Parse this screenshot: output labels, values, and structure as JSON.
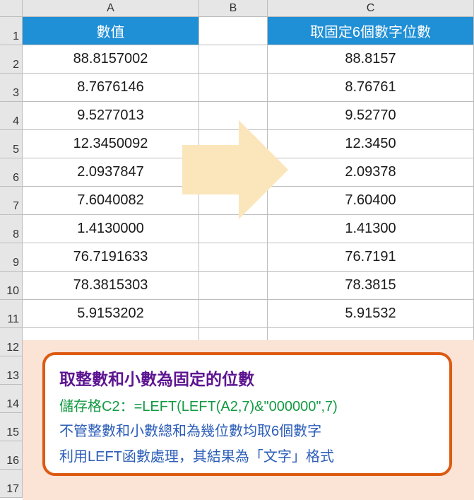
{
  "columns": {
    "A": "A",
    "B": "B",
    "C": "C"
  },
  "headers": {
    "A": "數值",
    "C": "取固定6個數字位數"
  },
  "rows": [
    {
      "n": "1"
    },
    {
      "n": "2",
      "a": "88.8157002",
      "c": "88.8157"
    },
    {
      "n": "3",
      "a": "8.7676146",
      "c": "8.76761"
    },
    {
      "n": "4",
      "a": "9.5277013",
      "c": "9.52770"
    },
    {
      "n": "5",
      "a": "12.3450092",
      "c": "12.3450"
    },
    {
      "n": "6",
      "a": "2.0937847",
      "c": "2.09378"
    },
    {
      "n": "7",
      "a": "7.6040082",
      "c": "7.60400"
    },
    {
      "n": "8",
      "a": "1.4130000",
      "c": "1.41300"
    },
    {
      "n": "9",
      "a": "76.7191633",
      "c": "76.7191"
    },
    {
      "n": "10",
      "a": "78.3815303",
      "c": "78.3815"
    },
    {
      "n": "11",
      "a": "5.9153202",
      "c": "5.91532"
    },
    {
      "n": "12"
    },
    {
      "n": "13"
    },
    {
      "n": "14"
    },
    {
      "n": "15"
    },
    {
      "n": "16"
    },
    {
      "n": "17"
    }
  ],
  "box": {
    "title": "取整數和小數為固定的位數",
    "formula": "儲存格C2：=LEFT(LEFT(A2,7)&\"000000\",7)",
    "note1": "不管整數和小數總和為幾位數均取6個數字",
    "note2": "利用LEFT函數處理，其結果為「文字」格式"
  },
  "chart_data": {
    "type": "table",
    "title": "Excel: fixed 6-digit extraction using LEFT",
    "columns": [
      "數值",
      "取固定6個數字位數"
    ],
    "data": [
      [
        "88.8157002",
        "88.8157"
      ],
      [
        "8.7676146",
        "8.76761"
      ],
      [
        "9.5277013",
        "9.52770"
      ],
      [
        "12.3450092",
        "12.3450"
      ],
      [
        "2.0937847",
        "2.09378"
      ],
      [
        "7.6040082",
        "7.60400"
      ],
      [
        "1.4130000",
        "1.41300"
      ],
      [
        "76.7191633",
        "76.7191"
      ],
      [
        "78.3815303",
        "78.3815"
      ],
      [
        "5.9153202",
        "5.91532"
      ]
    ]
  }
}
